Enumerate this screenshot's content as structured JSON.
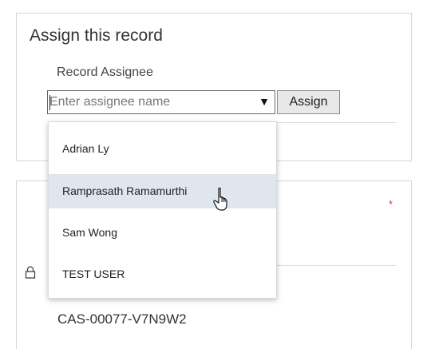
{
  "assign_panel": {
    "title": "Assign this record",
    "field_label": "Record Assignee",
    "input_placeholder": "Enter assignee name",
    "input_value": "",
    "dropdown_arrow": "▼",
    "assign_button": "Assign"
  },
  "dropdown": {
    "options": [
      {
        "label": "Adrian Ly",
        "hovered": false
      },
      {
        "label": "Ramprasath Ramamurthi",
        "hovered": true
      },
      {
        "label": "Sam Wong",
        "hovered": false
      },
      {
        "label": "TEST USER",
        "hovered": false
      }
    ]
  },
  "record_panel": {
    "required_marker": "*",
    "case_number": "CAS-00077-V7N9W2",
    "lock_icon": "lock-icon"
  },
  "colors": {
    "hover_background": "#dfe6ee",
    "required": "#d13438"
  }
}
